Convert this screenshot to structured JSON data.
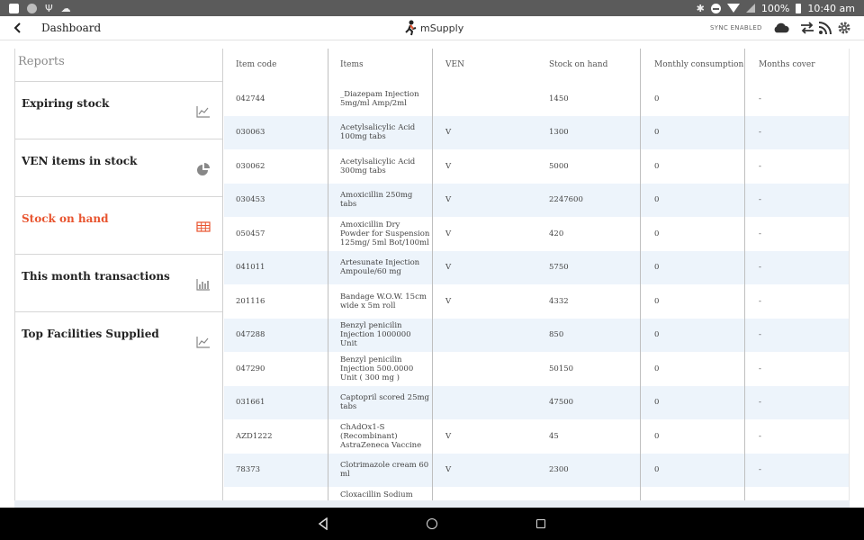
{
  "status_bar": {
    "battery": "100%",
    "time": "10:40 am"
  },
  "header": {
    "title": "Dashboard",
    "logo_text": "mSupply",
    "sync_label": "SYNC ENABLED"
  },
  "sidebar": {
    "header": "Reports",
    "items": [
      {
        "label": "Expiring stock",
        "icon": "line-chart-icon"
      },
      {
        "label": "VEN items in stock",
        "icon": "pie-chart-icon"
      },
      {
        "label": "Stock on hand",
        "icon": "table-icon",
        "active": true
      },
      {
        "label": "This month transactions",
        "icon": "bar-chart-icon"
      },
      {
        "label": "Top Facilities Supplied",
        "icon": "line-chart-icon"
      }
    ]
  },
  "table": {
    "columns": [
      "Item code",
      "Items",
      "VEN",
      "Stock on hand",
      "Monthly consumption",
      "Months cover"
    ],
    "rows": [
      {
        "code": "042744",
        "item": "_Diazepam Injection 5mg/ml Amp/2ml",
        "ven": "",
        "stock": "1450",
        "consumption": "0",
        "cover": "-"
      },
      {
        "code": "030063",
        "item": "Acetylsalicylic Acid 100mg tabs",
        "ven": "V",
        "stock": "1300",
        "consumption": "0",
        "cover": "-"
      },
      {
        "code": "030062",
        "item": "Acetylsalicylic Acid 300mg tabs",
        "ven": "V",
        "stock": "5000",
        "consumption": "0",
        "cover": "-"
      },
      {
        "code": "030453",
        "item": "Amoxicillin 250mg tabs",
        "ven": "V",
        "stock": "2247600",
        "consumption": "0",
        "cover": "-"
      },
      {
        "code": "050457",
        "item": "Amoxicillin Dry Powder for Suspension 125mg/ 5ml Bot/100ml",
        "ven": "V",
        "stock": "420",
        "consumption": "0",
        "cover": "-"
      },
      {
        "code": "041011",
        "item": "Artesunate Injection Ampoule/60 mg",
        "ven": "V",
        "stock": "5750",
        "consumption": "0",
        "cover": "-"
      },
      {
        "code": "201116",
        "item": "Bandage W.O.W. 15cm wide x 5m roll",
        "ven": "V",
        "stock": "4332",
        "consumption": "0",
        "cover": "-"
      },
      {
        "code": "047288",
        "item": "Benzyl penicilin Injection 1000000 Unit",
        "ven": "",
        "stock": "850",
        "consumption": "0",
        "cover": "-"
      },
      {
        "code": "047290",
        "item": "Benzyl penicilin Injection 500.0000 Unit ( 300 mg )",
        "ven": "",
        "stock": "50150",
        "consumption": "0",
        "cover": "-"
      },
      {
        "code": "031661",
        "item": "Captopril scored 25mg tabs",
        "ven": "",
        "stock": "47500",
        "consumption": "0",
        "cover": "-"
      },
      {
        "code": "AZD1222",
        "item": "ChAdOx1-S (Recombinant) AstraZeneca Vaccine",
        "ven": "V",
        "stock": "45",
        "consumption": "0",
        "cover": "-"
      },
      {
        "code": "78373",
        "item": "Clotrimazole cream 60 ml",
        "ven": "V",
        "stock": "2300",
        "consumption": "0",
        "cover": "-"
      },
      {
        "code": "",
        "item": "Cloxacillin Sodium",
        "ven": "",
        "stock": "",
        "consumption": "",
        "cover": ""
      }
    ]
  },
  "colors": {
    "accent": "#e8542f",
    "status_bar": "#5b5b5b",
    "row_alt": "#edf4fb"
  }
}
